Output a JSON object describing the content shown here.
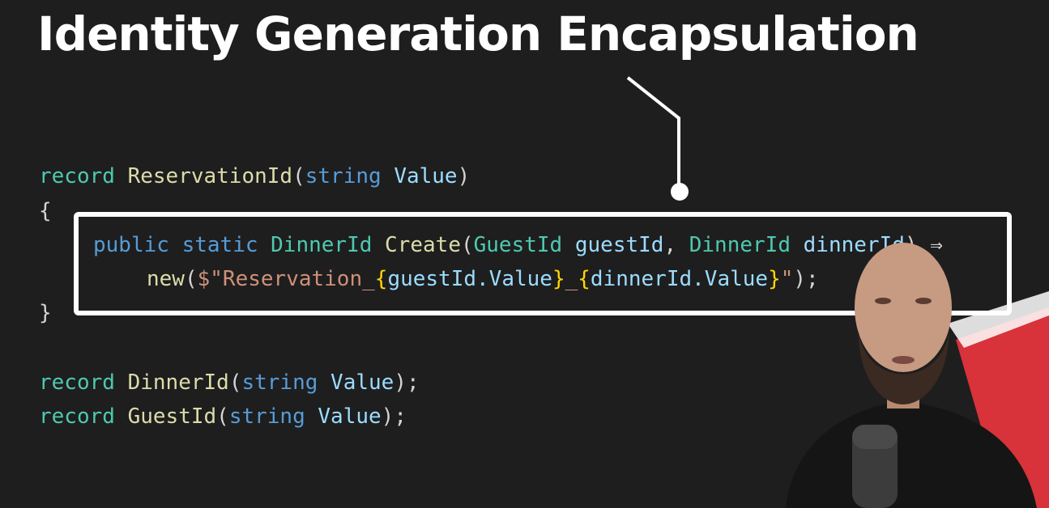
{
  "title": "Identity Generation Encapsulation",
  "code": {
    "line1": {
      "kw": "record",
      "name": "ReservationId",
      "open": "(",
      "ptype": "string",
      "pname": "Value",
      "close": ")"
    },
    "line2": "{",
    "line3": {
      "kw1": "public",
      "kw2": "static",
      "rtype": "DinnerId",
      "method": "Create",
      "open": "(",
      "p1type": "GuestId",
      "p1name": "guestId",
      "comma": ",",
      "p2type": "DinnerId",
      "p2name": "dinnerId",
      "close": ")",
      "arrow": "⇒"
    },
    "line4": {
      "kw": "new",
      "open": "(",
      "str_a": "$\"Reservation_",
      "b1o": "{",
      "expr1": "guestId.Value",
      "b1c": "}",
      "str_b": "_",
      "b2o": "{",
      "expr2": "dinnerId.Value",
      "b2c": "}",
      "str_c": "\"",
      "close": ");"
    },
    "line5": "}",
    "line6": {
      "kw": "record",
      "name": "DinnerId",
      "open": "(",
      "ptype": "string",
      "pname": "Value",
      "close": ");"
    },
    "line7": {
      "kw": "record",
      "name": "GuestId",
      "open": "(",
      "ptype": "string",
      "pname": "Value",
      "close": ");"
    }
  },
  "colors": {
    "background": "#1e1e1f",
    "highlight_border": "#ffffff",
    "accent_red": "#d8323a"
  }
}
